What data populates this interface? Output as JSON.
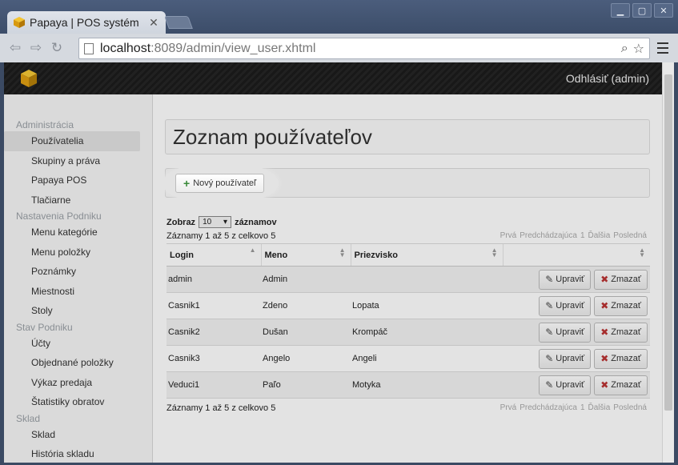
{
  "browser": {
    "tab_title": "Papaya | POS systém",
    "url_host": "localhost",
    "url_rest": ":8089/admin/view_user.xhtml",
    "window_buttons": [
      "▁",
      "▢",
      "✕"
    ]
  },
  "app": {
    "logout_label": "Odhlásiť (admin)"
  },
  "sidebar": {
    "groups": [
      {
        "label": "Administrácia",
        "items": [
          "Používatelia",
          "Skupiny a práva",
          "Papaya POS",
          "Tlačiarne"
        ]
      },
      {
        "label": "Nastavenia Podniku",
        "items": [
          "Menu kategórie",
          "Menu položky",
          "Poznámky",
          "Miestnosti",
          "Stoly"
        ]
      },
      {
        "label": "Stav Podniku",
        "items": [
          "Účty",
          "Objednané položky",
          "Výkaz predaja",
          "Štatistiky obratov"
        ]
      },
      {
        "label": "Sklad",
        "items": [
          "Sklad",
          "História skladu"
        ]
      }
    ],
    "active_item": "Používatelia"
  },
  "main": {
    "title": "Zoznam používateľov",
    "new_user_label": "Nový používateľ",
    "length_prefix": "Zobraz",
    "length_value": "10",
    "length_suffix": "záznamov",
    "info_text": "Záznamy 1 až 5 z celkovo 5",
    "pager": [
      "Prvá",
      "Predchádzajúca",
      "1",
      "Ďalšia",
      "Posledná"
    ],
    "columns": [
      "Login",
      "Meno",
      "Priezvisko",
      ""
    ],
    "edit_label": "Upraviť",
    "delete_label": "Zmazať",
    "rows": [
      {
        "login": "admin",
        "meno": "Admin",
        "priezvisko": ""
      },
      {
        "login": "Casnik1",
        "meno": "Zdeno",
        "priezvisko": "Lopata"
      },
      {
        "login": "Casnik2",
        "meno": "Dušan",
        "priezvisko": "Krompáč"
      },
      {
        "login": "Casnik3",
        "meno": "Angelo",
        "priezvisko": "Angeli"
      },
      {
        "login": "Veduci1",
        "meno": "Paľo",
        "priezvisko": "Motyka"
      }
    ]
  }
}
